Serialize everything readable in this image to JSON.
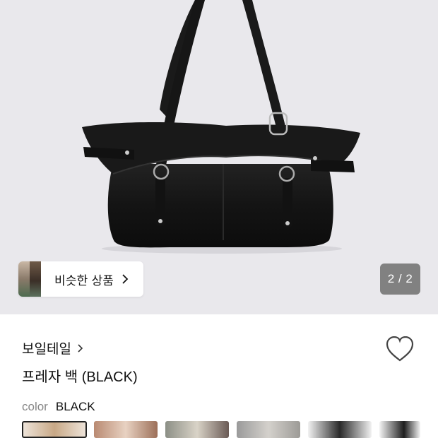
{
  "hero": {
    "similar_products_label": "비슷한 상품",
    "page_counter": "2 / 2"
  },
  "product": {
    "brand": "보일테일",
    "title": "프레자 백 (BLACK)",
    "color_key": "color",
    "color_value": "BLACK"
  },
  "colors": {
    "hero_background": "#e9e8ec",
    "bag": "#111111",
    "counter_background": "#6e6e6e"
  },
  "icons": [
    "chevron-right-icon",
    "heart-icon"
  ]
}
